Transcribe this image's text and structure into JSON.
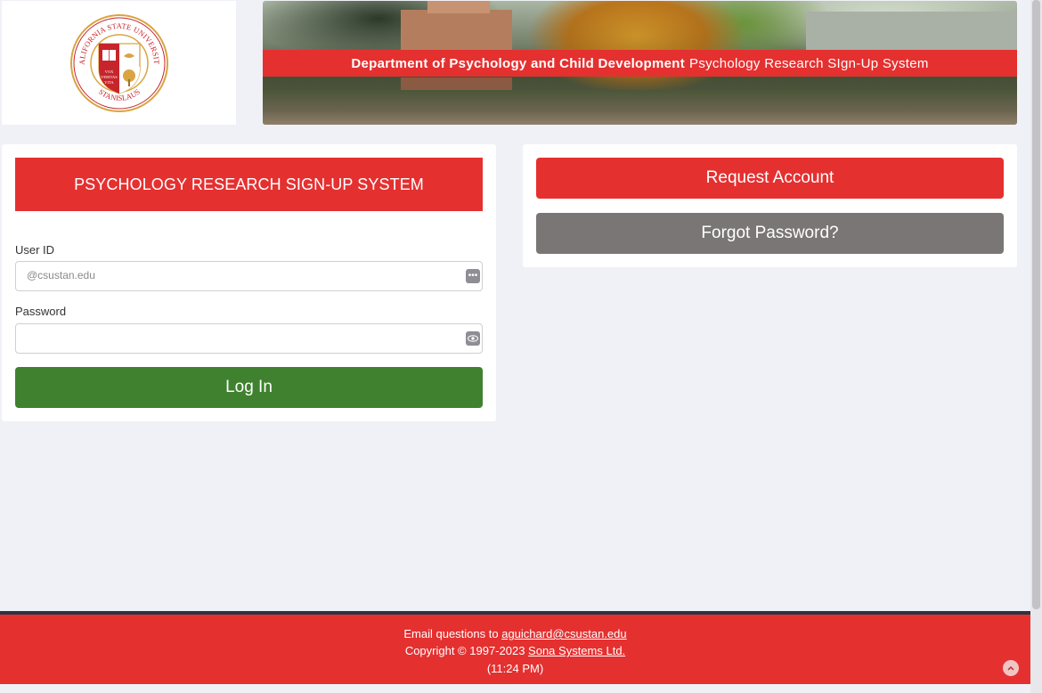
{
  "header": {
    "logo": {
      "name": "csu-stanislaus-seal",
      "ring_text": "CALIFORNIA STATE UNIVERSITY",
      "bottom_text": "STANISLAUS",
      "motto": [
        "VOX",
        "VERITAS",
        "VITA"
      ],
      "colors": {
        "ring": "#c8242b",
        "gold": "#d9a441"
      }
    },
    "banner": {
      "department": "Department of Psychology and Child Development",
      "system": "Psychology Research SIgn-Up System"
    }
  },
  "login": {
    "title": "PSYCHOLOGY RESEARCH SIGN-UP SYSTEM",
    "user_id_label": "User ID",
    "user_id_placeholder": "@csustan.edu",
    "user_id_value": "",
    "user_id_icon": "dots-icon",
    "password_label": "Password",
    "password_value": "",
    "password_icon": "eye-icon",
    "login_button": "Log In"
  },
  "actions": {
    "request_account": "Request Account",
    "forgot_password": "Forgot Password?"
  },
  "footer": {
    "email_prefix": "Email questions to ",
    "email": "aguichard@csustan.edu",
    "copyright_prefix": "Copyright © 1997-2023 ",
    "company": "Sona Systems Ltd.",
    "time": "(11:24 PM)",
    "back_to_top_icon": "chevron-up-icon"
  },
  "colors": {
    "brand_red": "#e53030",
    "login_green": "#3f812f",
    "secondary_gray": "#7b7676",
    "page_bg": "#f0f1f6",
    "footer_border": "#2f3340"
  }
}
